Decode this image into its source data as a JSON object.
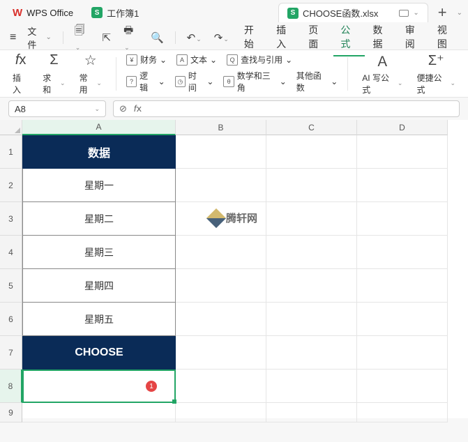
{
  "app": {
    "name": "WPS Office"
  },
  "tabs": [
    {
      "label": "工作簿1",
      "active": false
    },
    {
      "label": "CHOOSE函数.xlsx",
      "active": true
    }
  ],
  "file_menu_label": "文件",
  "menu": {
    "items": [
      "开始",
      "插入",
      "页面",
      "公式",
      "数据",
      "审阅",
      "视图"
    ],
    "active_index": 3
  },
  "ribbon": {
    "insert": {
      "label": "插入"
    },
    "sum": {
      "label": "求和"
    },
    "common": {
      "label": "常用"
    },
    "row1": {
      "finance": "财务",
      "text": "文本",
      "lookup": "查找与引用"
    },
    "row2": {
      "logic": "逻辑",
      "time": "时间",
      "math": "数学和三角",
      "other": "其他函数"
    },
    "ai": {
      "label": "AI 写公式"
    },
    "quick": {
      "label": "便捷公式"
    }
  },
  "namebox": "A8",
  "columns": [
    "A",
    "B",
    "C",
    "D"
  ],
  "rows": [
    "1",
    "2",
    "3",
    "4",
    "5",
    "6",
    "7",
    "8",
    "9"
  ],
  "cells": {
    "A1": "数据",
    "A2": "星期一",
    "A3": "星期二",
    "A4": "星期三",
    "A5": "星期四",
    "A6": "星期五",
    "A7": "CHOOSE"
  },
  "selected_cell": "A8",
  "badge_num": "1",
  "watermark": "腾轩网"
}
